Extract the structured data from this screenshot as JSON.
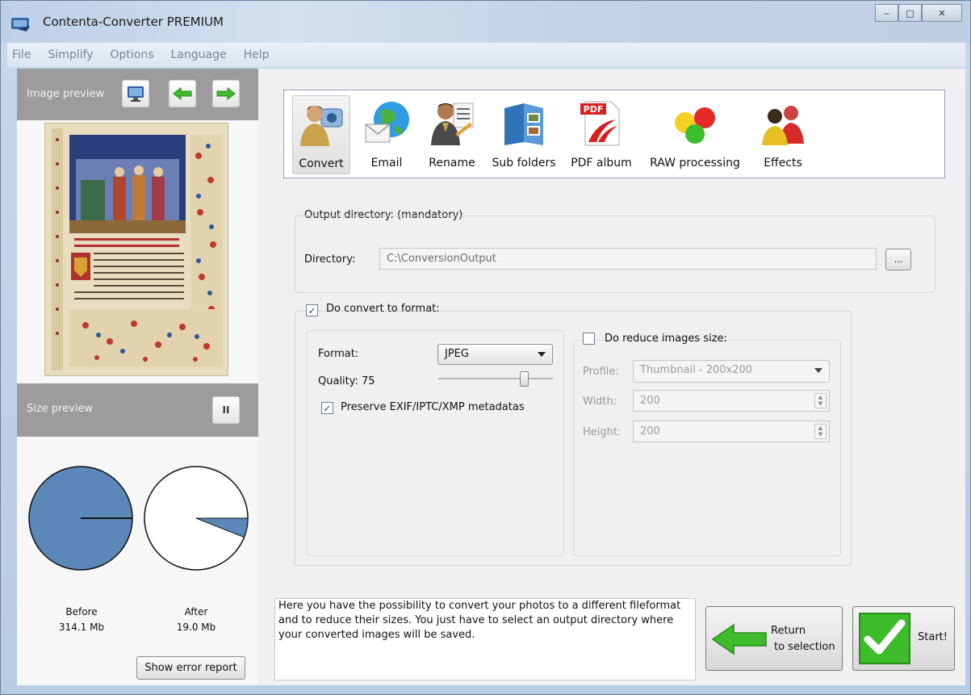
{
  "window": {
    "title": "Contenta-Converter PREMIUM",
    "controls": {
      "minimize": "‒",
      "maximize": "□",
      "close": "✕"
    }
  },
  "menu": [
    "File",
    "Simplify",
    "Options",
    "Language",
    "Help"
  ],
  "left_panel": {
    "image_preview_label": "Image preview",
    "size_preview_label": "Size preview",
    "pause_symbol": "II",
    "before": {
      "label": "Before",
      "value": "314.1 Mb"
    },
    "after": {
      "label": "After",
      "value": "19.0 Mb",
      "fraction": 0.06
    },
    "show_error_report": "Show error report"
  },
  "toolbar": [
    {
      "label": "Convert",
      "icon": "convert-person-icon"
    },
    {
      "label": "Email",
      "icon": "email-globe-icon"
    },
    {
      "label": "Rename",
      "icon": "rename-person-icon"
    },
    {
      "label": "Sub folders",
      "icon": "subfolders-book-icon"
    },
    {
      "label": "PDF album",
      "icon": "pdf-icon"
    },
    {
      "label": "RAW processing",
      "icon": "raw-balls-icon"
    },
    {
      "label": "Effects",
      "icon": "effects-people-icon"
    }
  ],
  "output": {
    "group_label": "Output directory: (mandatory)",
    "directory_label": "Directory:",
    "directory_value": "C:\\ConversionOutput",
    "browse_label": "..."
  },
  "convert": {
    "checkbox_label": "Do convert to format:",
    "checked": true,
    "format_label": "Format:",
    "format_value": "JPEG",
    "quality_label": "Quality: 75",
    "quality_value": 75,
    "preserve_label": "Preserve EXIF/IPTC/XMP metadatas",
    "preserve_checked": true
  },
  "reduce": {
    "checkbox_label": "Do reduce images size:",
    "checked": false,
    "profile_label": "Profile:",
    "profile_value": "Thumbnail - 200x200",
    "width_label": "Width:",
    "width_value": "200",
    "height_label": "Height:",
    "height_value": "200"
  },
  "description": "Here you have the possibility to convert your photos to a different fileformat and to reduce their sizes. You just have to select an output directory where your converted images will be saved.",
  "buttons": {
    "return_line1": "Return",
    "return_line2": "to selection",
    "start": "Start!"
  },
  "colors": {
    "pie_fill": "#5b88b9",
    "panel_bar": "#9c9c9c",
    "arrow_green": "#3dbb2a"
  }
}
